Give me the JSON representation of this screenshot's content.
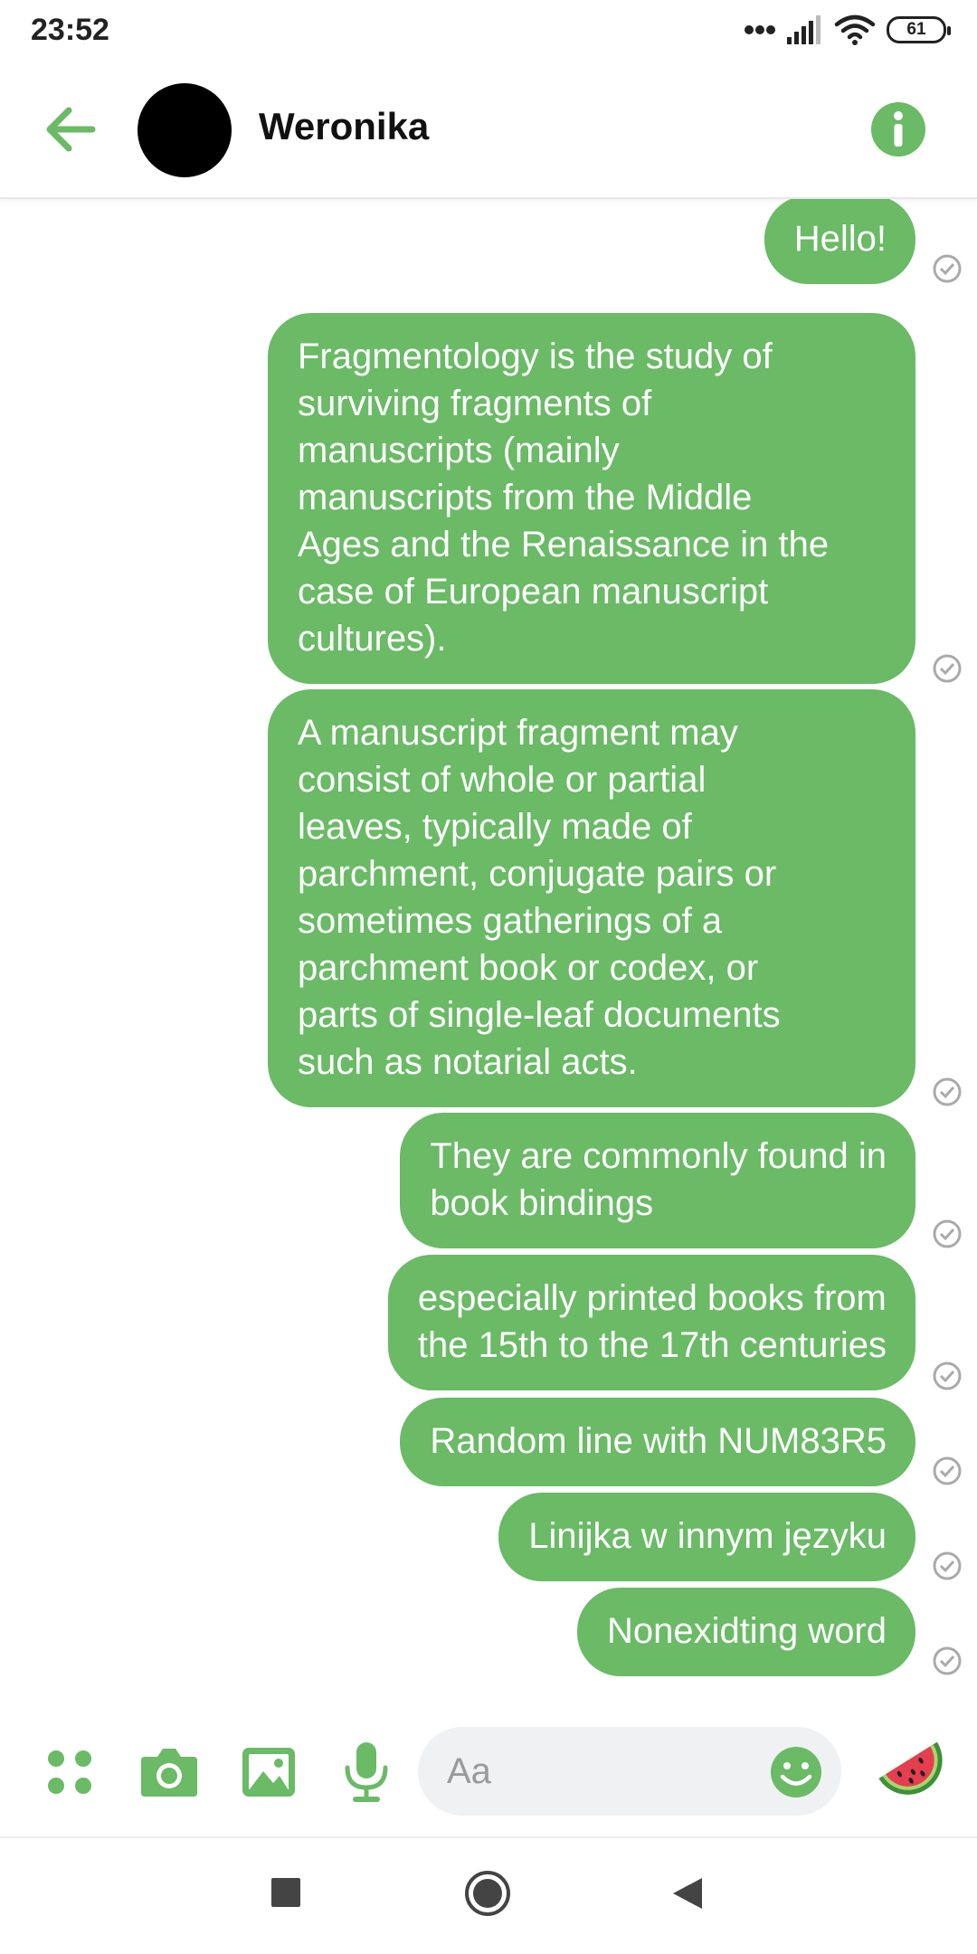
{
  "status_bar": {
    "time": "23:52",
    "battery": "61",
    "icons": [
      "signal-dots-icon",
      "signal-bars-icon",
      "wifi-icon",
      "battery-icon"
    ]
  },
  "header": {
    "contact_name": "Weronika",
    "back_icon": "arrow-left-icon",
    "info_icon": "info-icon"
  },
  "messages": [
    {
      "text": "Hello!",
      "status_icon": "sent-check-icon"
    },
    {
      "text": "Fragmentology is the study of\nsurviving fragments of\nmanuscripts (mainly\nmanuscripts from the Middle\nAges and the Renaissance in the\ncase of European manuscript\ncultures).",
      "status_icon": "sent-check-icon"
    },
    {
      "text": "A manuscript fragment may\nconsist of whole or partial\nleaves, typically made of\nparchment, conjugate pairs or\nsometimes gatherings of a\nparchment book or codex, or\nparts of single-leaf documents\nsuch as notarial acts.",
      "status_icon": "sent-check-icon"
    },
    {
      "text": "They are commonly found in\nbook bindings",
      "status_icon": "sent-check-icon"
    },
    {
      "text": "especially printed books from\nthe 15th to the 17th centuries",
      "status_icon": "sent-check-icon"
    },
    {
      "text": "Random line with NUM83R5",
      "status_icon": "sent-check-icon"
    },
    {
      "text": "Linijka w innym języku",
      "status_icon": "sent-check-icon"
    },
    {
      "text": "Nonexidting word",
      "status_icon": "sent-check-icon"
    }
  ],
  "composer": {
    "placeholder": "Aa",
    "value": "",
    "icons": [
      "apps-icon",
      "camera-icon",
      "gallery-icon",
      "microphone-icon",
      "emoji-icon",
      "watermelon-icon"
    ]
  },
  "nav_bar": {
    "icons": [
      "recents-square-icon",
      "home-circle-icon",
      "back-triangle-icon"
    ]
  },
  "colors": {
    "accent": "#6aba66",
    "bubble_text": "#ffffff",
    "input_bg": "#f0f1f3"
  }
}
